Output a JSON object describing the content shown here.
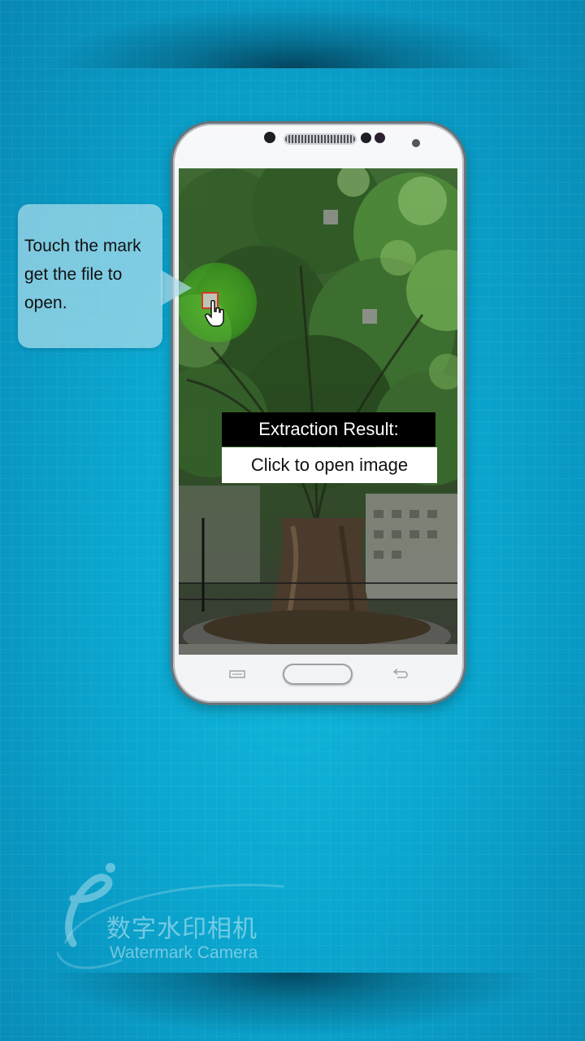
{
  "callout": {
    "text_line1": "Touch the mark",
    "text_line2": "get the file to",
    "text_line3": "open."
  },
  "result": {
    "header": "Extraction Result:",
    "button_label": "Click to open image"
  },
  "logo": {
    "letter": "e",
    "chinese": "数字水印相机",
    "english": "Watermark Camera"
  },
  "colors": {
    "background": "#0aa6cf",
    "callout": "#aadceb",
    "mark_border": "#d23a2a"
  }
}
